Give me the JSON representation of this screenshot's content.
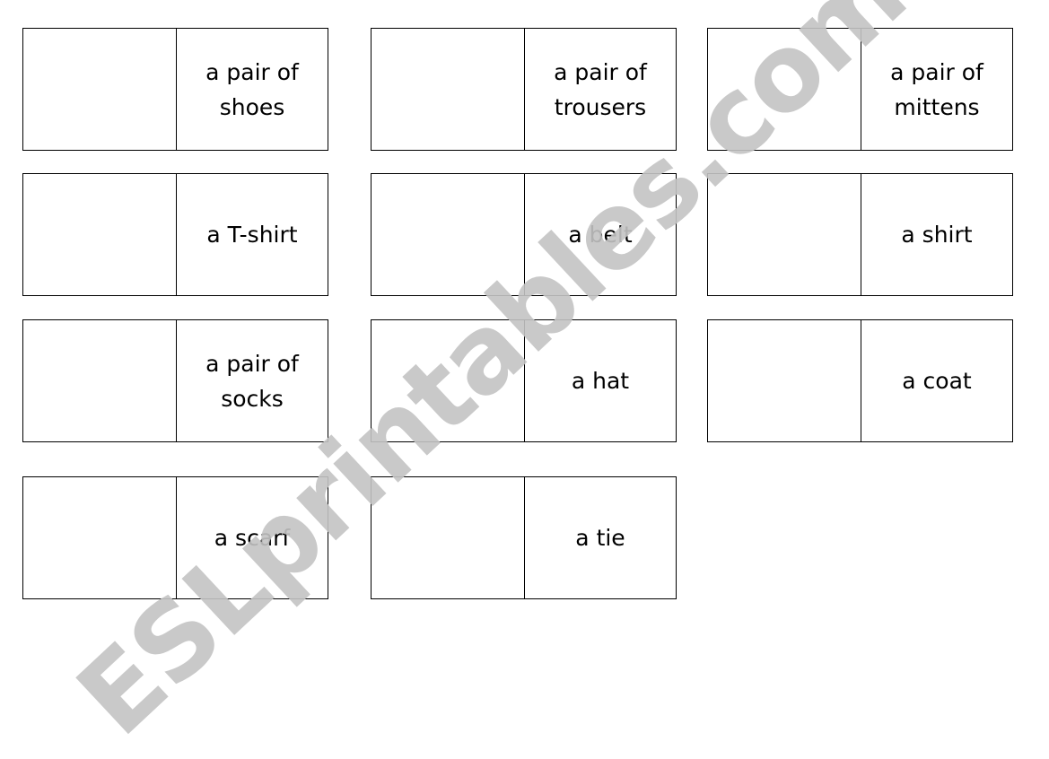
{
  "cards": [
    {
      "label": "a pair of shoes"
    },
    {
      "label": "a pair of trousers"
    },
    {
      "label": "a pair of mittens"
    },
    {
      "label": "a T-shirt"
    },
    {
      "label": "a belt"
    },
    {
      "label": "a shirt"
    },
    {
      "label": "a pair of socks"
    },
    {
      "label": "a hat"
    },
    {
      "label": "a coat"
    },
    {
      "label": "a scarf"
    },
    {
      "label": "a tie"
    }
  ],
  "watermark": "ESLprintables.com"
}
